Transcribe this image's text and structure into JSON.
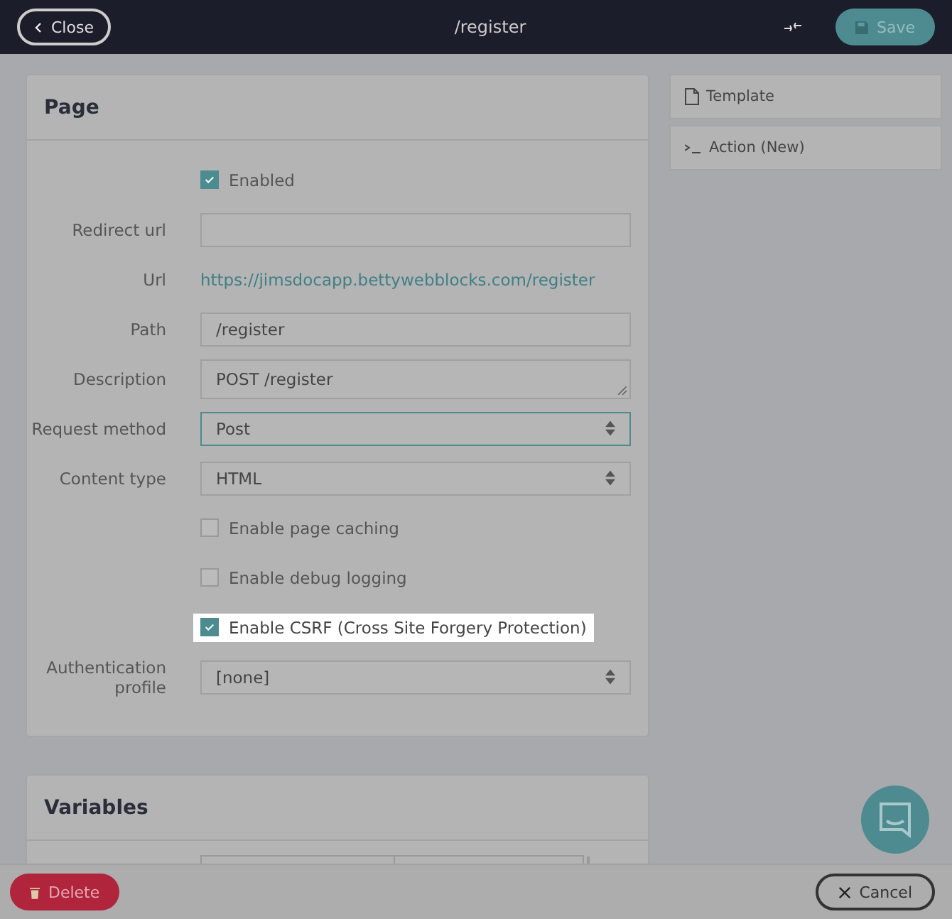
{
  "header": {
    "close_button": "Close",
    "title": "/register",
    "save_button": "Save"
  },
  "page_panel": {
    "title": "Page",
    "rows": [
      {
        "kind": "checkbox",
        "text": "Enabled",
        "checked": true,
        "highlighted": false
      },
      {
        "kind": "input",
        "label": "Redirect url"
      },
      {
        "kind": "link",
        "label": "Url",
        "text": "https://jimsdocapp.bettywebblocks.com/register"
      },
      {
        "kind": "input",
        "label": "Path",
        "value": "/register"
      },
      {
        "kind": "textarea",
        "label": "Description",
        "value": "POST /register"
      },
      {
        "kind": "select",
        "label": "Request method",
        "value": "Post",
        "focused": true
      },
      {
        "kind": "select",
        "label": "Content type",
        "value": "HTML",
        "focused": false
      },
      {
        "kind": "checkbox",
        "text": "Enable page caching",
        "checked": false,
        "highlighted": false
      },
      {
        "kind": "checkbox",
        "text": "Enable debug logging",
        "checked": false,
        "highlighted": false
      },
      {
        "kind": "checkbox",
        "text": "Enable CSRF (Cross Site Forgery Protection)",
        "checked": true,
        "highlighted": true
      },
      {
        "kind": "select",
        "label": "Authentication profile",
        "value": "[none]",
        "focused": false
      }
    ]
  },
  "side_items": [
    {
      "kind": "template",
      "label": "Template"
    },
    {
      "kind": "action",
      "label": "Action (New)"
    }
  ],
  "variables_panel": {
    "title": "Variables"
  },
  "footer": {
    "delete_button": "Delete",
    "cancel_button": "Cancel"
  }
}
